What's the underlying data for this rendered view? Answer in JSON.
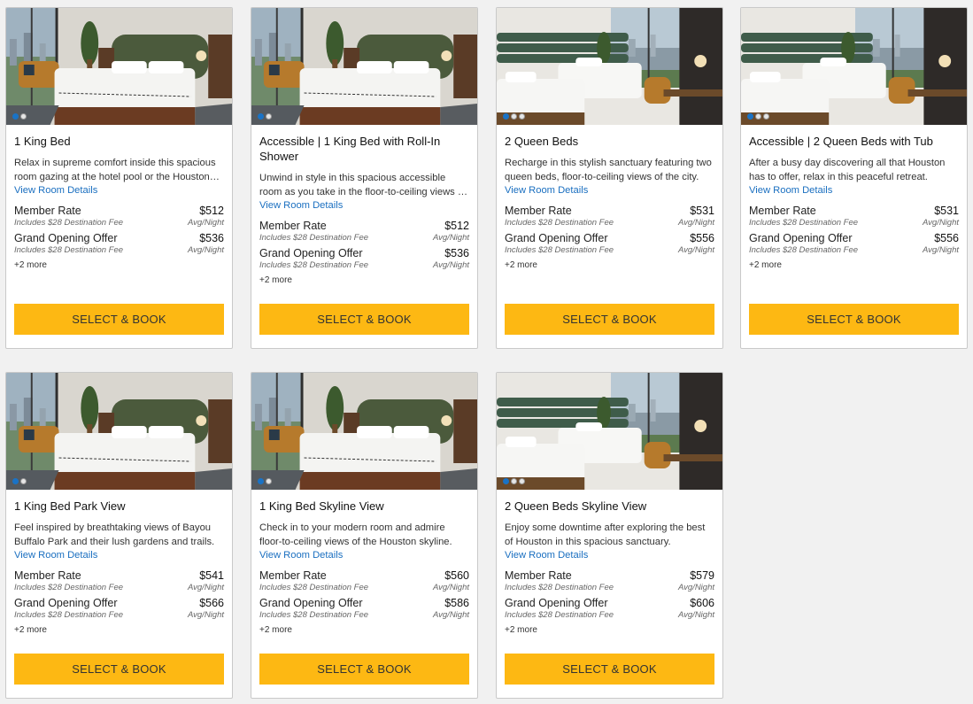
{
  "rooms": [
    {
      "title": "1 King Bed",
      "description": "Relax in supreme comfort inside this spacious room gazing at the hotel pool or the Houston skyline.",
      "details_link": "View Room Details",
      "rates": [
        {
          "name": "Member Rate",
          "fee": "Includes $28 Destination Fee",
          "price": "$512",
          "unit": "Avg/Night"
        },
        {
          "name": "Grand Opening Offer",
          "fee": "Includes $28 Destination Fee",
          "price": "$536",
          "unit": "Avg/Night"
        }
      ],
      "more": "+2 more",
      "button": "SELECT & BOOK",
      "photo_type": "king",
      "photo_count": 2
    },
    {
      "title": "Accessible | 1 King Bed with Roll-In Shower",
      "description": "Unwind in style in this spacious accessible room as you take in the floor-to-ceiling views of Houston.",
      "details_link": "View Room Details",
      "rates": [
        {
          "name": "Member Rate",
          "fee": "Includes $28 Destination Fee",
          "price": "$512",
          "unit": "Avg/Night"
        },
        {
          "name": "Grand Opening Offer",
          "fee": "Includes $28 Destination Fee",
          "price": "$536",
          "unit": "Avg/Night"
        }
      ],
      "more": "+2 more",
      "button": "SELECT & BOOK",
      "photo_type": "king",
      "photo_count": 2
    },
    {
      "title": "2 Queen Beds",
      "description": "Recharge in this stylish sanctuary featuring two queen beds, floor-to-ceiling views of the city.",
      "details_link": "View Room Details",
      "rates": [
        {
          "name": "Member Rate",
          "fee": "Includes $28 Destination Fee",
          "price": "$531",
          "unit": "Avg/Night"
        },
        {
          "name": "Grand Opening Offer",
          "fee": "Includes $28 Destination Fee",
          "price": "$556",
          "unit": "Avg/Night"
        }
      ],
      "more": "+2 more",
      "button": "SELECT & BOOK",
      "photo_type": "queen",
      "photo_count": 3
    },
    {
      "title": "Accessible | 2 Queen Beds with Tub",
      "description": "After a busy day discovering all that Houston has to offer, relax in this peaceful retreat.",
      "details_link": "View Room Details",
      "rates": [
        {
          "name": "Member Rate",
          "fee": "Includes $28 Destination Fee",
          "price": "$531",
          "unit": "Avg/Night"
        },
        {
          "name": "Grand Opening Offer",
          "fee": "Includes $28 Destination Fee",
          "price": "$556",
          "unit": "Avg/Night"
        }
      ],
      "more": "+2 more",
      "button": "SELECT & BOOK",
      "photo_type": "queen",
      "photo_count": 3
    },
    {
      "title": "1 King Bed Park View",
      "description": "Feel inspired by breathtaking views of Bayou Buffalo Park and their lush gardens and trails.",
      "details_link": "View Room Details",
      "rates": [
        {
          "name": "Member Rate",
          "fee": "Includes $28 Destination Fee",
          "price": "$541",
          "unit": "Avg/Night"
        },
        {
          "name": "Grand Opening Offer",
          "fee": "Includes $28 Destination Fee",
          "price": "$566",
          "unit": "Avg/Night"
        }
      ],
      "more": "+2 more",
      "button": "SELECT & BOOK",
      "photo_type": "king",
      "photo_count": 2
    },
    {
      "title": "1 King Bed Skyline View",
      "description": "Check in to your modern room and admire floor-to-ceiling views of the Houston skyline.",
      "details_link": "View Room Details",
      "rates": [
        {
          "name": "Member Rate",
          "fee": "Includes $28 Destination Fee",
          "price": "$560",
          "unit": "Avg/Night"
        },
        {
          "name": "Grand Opening Offer",
          "fee": "Includes $28 Destination Fee",
          "price": "$586",
          "unit": "Avg/Night"
        }
      ],
      "more": "+2 more",
      "button": "SELECT & BOOK",
      "photo_type": "king",
      "photo_count": 2
    },
    {
      "title": "2 Queen Beds Skyline View",
      "description": "Enjoy some downtime after exploring the best of Houston in this spacious sanctuary.",
      "details_link": "View Room Details",
      "rates": [
        {
          "name": "Member Rate",
          "fee": "Includes $28 Destination Fee",
          "price": "$579",
          "unit": "Avg/Night"
        },
        {
          "name": "Grand Opening Offer",
          "fee": "Includes $28 Destination Fee",
          "price": "$606",
          "unit": "Avg/Night"
        }
      ],
      "more": "+2 more",
      "button": "SELECT & BOOK",
      "photo_type": "queen",
      "photo_count": 3
    }
  ],
  "colors": {
    "button_bg": "#fdb813",
    "link": "#1a6fc0",
    "active_dot": "#1a73c6",
    "page_bg": "#f1f1f1"
  }
}
